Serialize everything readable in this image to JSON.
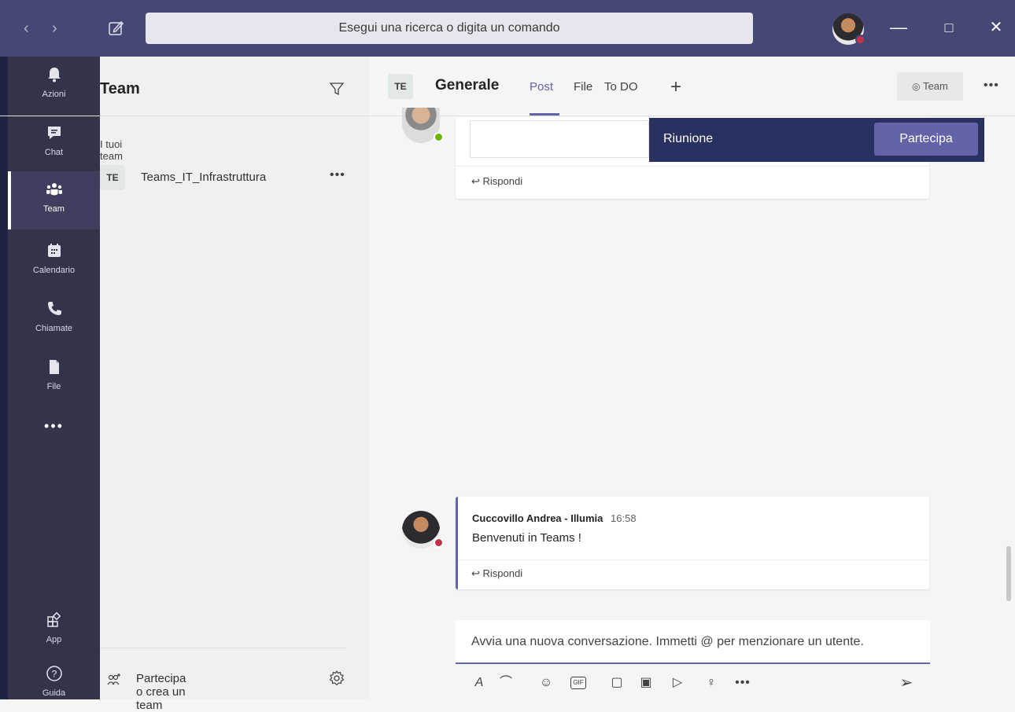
{
  "titlebar": {
    "search_placeholder": "Esegui una ricerca o digita un comando",
    "status_color": "#c4314b"
  },
  "rail": {
    "items": [
      {
        "label": "Azioni",
        "icon": "bell-icon"
      },
      {
        "label": "Chat",
        "icon": "chat-icon"
      },
      {
        "label": "Team",
        "icon": "teams-icon",
        "active": true
      },
      {
        "label": "Calendario",
        "icon": "calendar-icon"
      },
      {
        "label": "Chiamate",
        "icon": "phone-icon"
      },
      {
        "label": "File",
        "icon": "file-icon"
      }
    ],
    "more": "•••",
    "bottom": [
      {
        "label": "App",
        "icon": "apps-icon"
      },
      {
        "label": "Guida",
        "icon": "help-icon"
      }
    ]
  },
  "teamlist": {
    "title": "Team",
    "group_label": "I tuoi team",
    "teams": [
      {
        "initials": "TE",
        "name": "Teams_IT_Infrastruttura"
      }
    ],
    "more": "•••",
    "join_label": "Partecipa o crea un team"
  },
  "channel": {
    "initials": "TE",
    "name": "Generale",
    "tabs": [
      "Post",
      "File",
      "To DO"
    ],
    "active_tab": "Post",
    "add_tab": "+",
    "team_pill": "Team",
    "more": "•••"
  },
  "meeting": {
    "label": "Riunione",
    "join": "Partecipa"
  },
  "messages": [
    {
      "author": "Cuccovillo Andrea - Illumia",
      "time": "16:58",
      "text": "Benvenuti in Teams !",
      "reply": "Rispondi"
    }
  ],
  "top_reply": "Rispondi",
  "compose": {
    "placeholder": "Avvia una nuova conversazione. Immetti @ per menzionare un utente."
  },
  "colors": {
    "accent": "#6264a7",
    "titlebar": "#464775",
    "rail": "#33344a",
    "online": "#6bb700",
    "busy": "#c4314b"
  }
}
